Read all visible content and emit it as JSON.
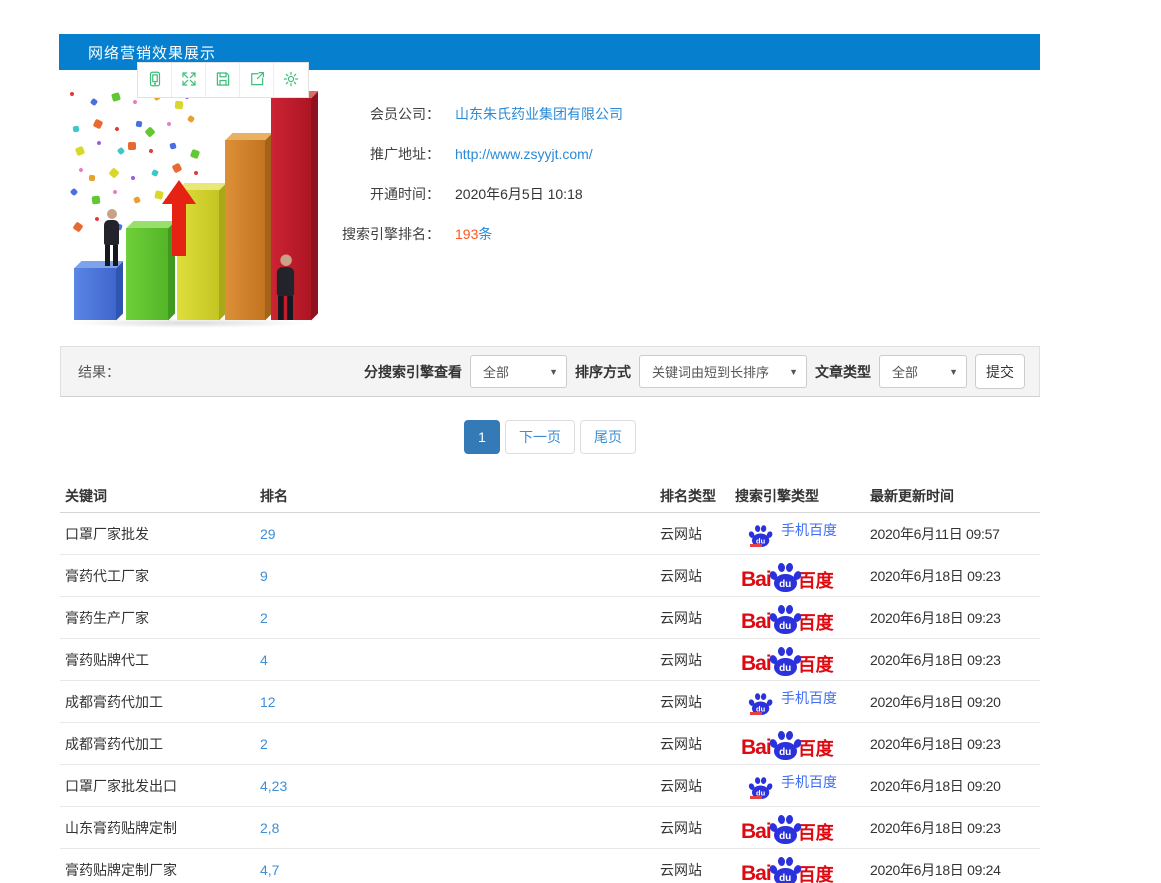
{
  "app": {
    "title": "网络营销效果展示"
  },
  "toolbar": {
    "icons": [
      "mobile-preview-icon",
      "fullscreen-icon",
      "save-icon",
      "share-icon",
      "settings-icon"
    ]
  },
  "info": {
    "member_company": {
      "label": "会员公司：",
      "value": "山东朱氏药业集团有限公司"
    },
    "promo_url": {
      "label": "推广地址：",
      "value": "http://www.zsyyjt.com/"
    },
    "open_time": {
      "label": "开通时间：",
      "value": "2020年6月5日 10:18"
    },
    "seo_rank": {
      "label": "搜索引擎排名：",
      "count": "193",
      "unit": "条"
    }
  },
  "filter": {
    "result_label": "结果：",
    "engine_filter_label": "分搜索引擎查看",
    "engine_filter_value": "全部",
    "sort_label": "排序方式",
    "sort_value": "关键词由短到长排序",
    "article_type_label": "文章类型",
    "article_type_value": "全部",
    "submit_label": "提交"
  },
  "pagination": {
    "current": "1",
    "next_label": "下一页",
    "last_label": "尾页"
  },
  "table": {
    "headers": [
      "关键词",
      "排名",
      "排名类型",
      "搜索引擎类型",
      "最新更新时间"
    ],
    "baidu_logo": {
      "text_bai": "Bai",
      "text_du": "du",
      "text_cn": "百度"
    },
    "mobile_baidu_label": "手机百度",
    "rows": [
      {
        "keyword": "口罩厂家批发",
        "rank": "29",
        "rank_type": "云网站",
        "engine": "mobile_baidu",
        "updated": "2020年6月11日 09:57"
      },
      {
        "keyword": "膏药代工厂家",
        "rank": "9",
        "rank_type": "云网站",
        "engine": "baidu",
        "updated": "2020年6月18日 09:23"
      },
      {
        "keyword": "膏药生产厂家",
        "rank": "2",
        "rank_type": "云网站",
        "engine": "baidu",
        "updated": "2020年6月18日 09:23"
      },
      {
        "keyword": "膏药贴牌代工",
        "rank": "4",
        "rank_type": "云网站",
        "engine": "baidu",
        "updated": "2020年6月18日 09:23"
      },
      {
        "keyword": "成都膏药代加工",
        "rank": "12",
        "rank_type": "云网站",
        "engine": "mobile_baidu",
        "updated": "2020年6月18日 09:20"
      },
      {
        "keyword": "成都膏药代加工",
        "rank": "2",
        "rank_type": "云网站",
        "engine": "baidu",
        "updated": "2020年6月18日 09:23"
      },
      {
        "keyword": "口罩厂家批发出口",
        "rank": "4,23",
        "rank_type": "云网站",
        "engine": "mobile_baidu",
        "updated": "2020年6月18日 09:20"
      },
      {
        "keyword": "山东膏药贴牌定制",
        "rank": "2,8",
        "rank_type": "云网站",
        "engine": "baidu",
        "updated": "2020年6月18日 09:23"
      },
      {
        "keyword": "膏药贴牌定制厂家",
        "rank": "4,7",
        "rank_type": "云网站",
        "engine": "baidu",
        "updated": "2020年6月18日 09:24"
      }
    ]
  },
  "colors": {
    "header_blue": "#0680ce",
    "link_blue": "#2a8ad6",
    "rank_link_blue": "#3f8fd2",
    "count_red": "#ff5722",
    "toolbar_green": "#3dbd78",
    "baidu_red": "#dd0a12",
    "baidu_blue": "#2b32dc",
    "mobile_baidu_blue": "#3d6df2",
    "pagination_active_blue": "#337ab7"
  }
}
